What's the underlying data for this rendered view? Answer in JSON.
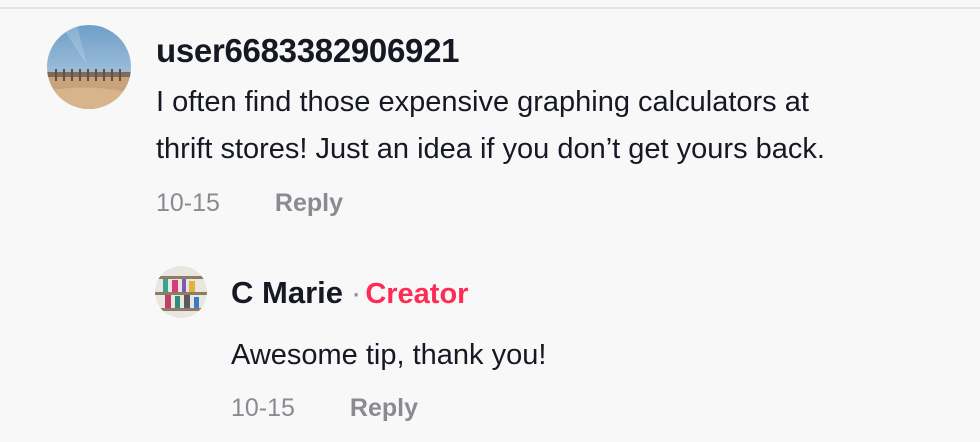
{
  "comment": {
    "username": "user6683382906921",
    "text_line_1": "I often find those expensive graphing calculators at",
    "text_line_2": "thrift stores! Just an idea if you don’t get yours back.",
    "date": "10-15",
    "reply_label": "Reply"
  },
  "reply": {
    "username": "C Marie",
    "separator": "·",
    "badge": "Creator",
    "text": "Awesome tip, thank you!",
    "date": "10-15",
    "reply_label": "Reply"
  },
  "colors": {
    "creator_badge": "#fe2c55",
    "meta_text": "#8a8b91",
    "primary_text": "#161823",
    "background": "#f8f8f8"
  }
}
